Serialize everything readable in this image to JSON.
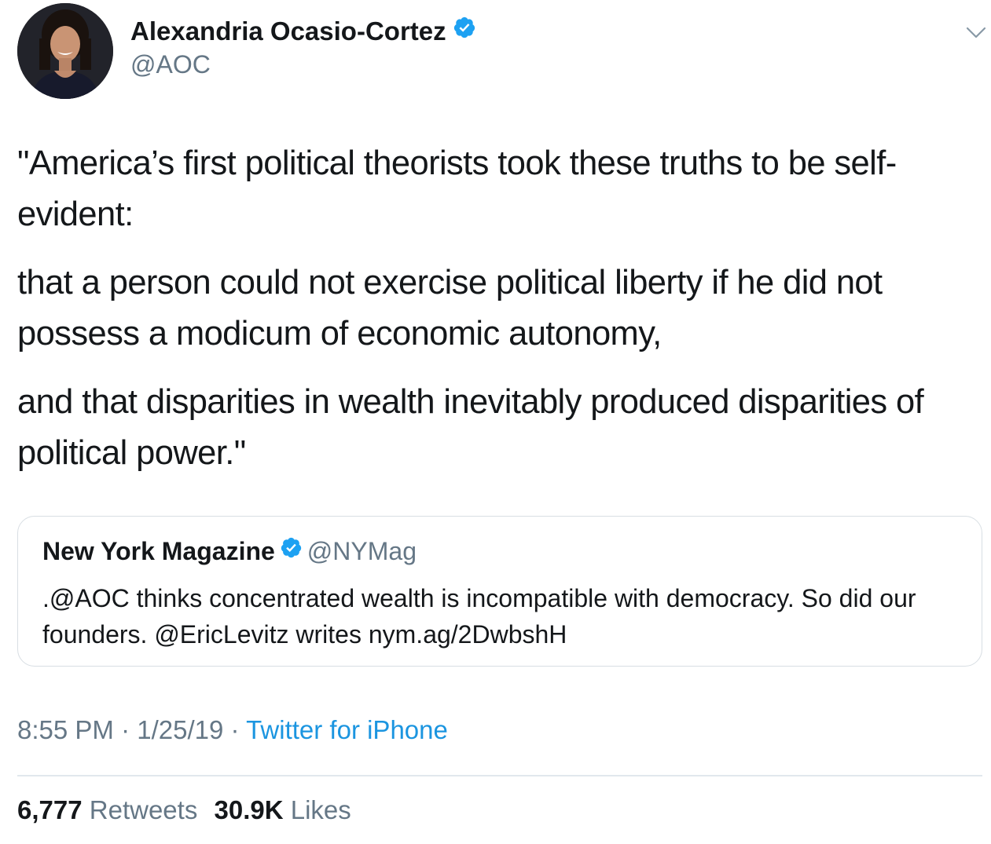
{
  "author": {
    "name": "Alexandria Ocasio-Cortez",
    "handle": "@AOC",
    "verified": true,
    "avatar_icon": "profile-photo"
  },
  "tweet": {
    "paragraphs": [
      "\"America’s first political theorists took these truths to be self-evident:",
      "that a person could not exercise political liberty if he did not possess a modicum of economic autonomy,",
      "and that disparities in wealth inevitably produced disparities of political power.\""
    ]
  },
  "quoted_tweet": {
    "name": "New York Magazine",
    "handle": "@NYMag",
    "verified": true,
    "text": ".@AOC thinks concentrated wealth is incompatible with democracy. So did our founders. @EricLevitz writes nym.ag/2DwbshH"
  },
  "meta": {
    "time": "8:55 PM",
    "separator": " · ",
    "date": "1/25/19",
    "source": "Twitter for iPhone"
  },
  "stats": {
    "retweets_count": "6,777",
    "retweets_label": "Retweets",
    "likes_count": "30.9K",
    "likes_label": "Likes"
  },
  "colors": {
    "verified_badge": "#1da1f2",
    "link": "#1b95e0",
    "secondary_text": "#657786",
    "border": "#e1e8ed"
  },
  "icons": {
    "verified": "verified-badge-icon",
    "menu": "chevron-down-icon"
  }
}
